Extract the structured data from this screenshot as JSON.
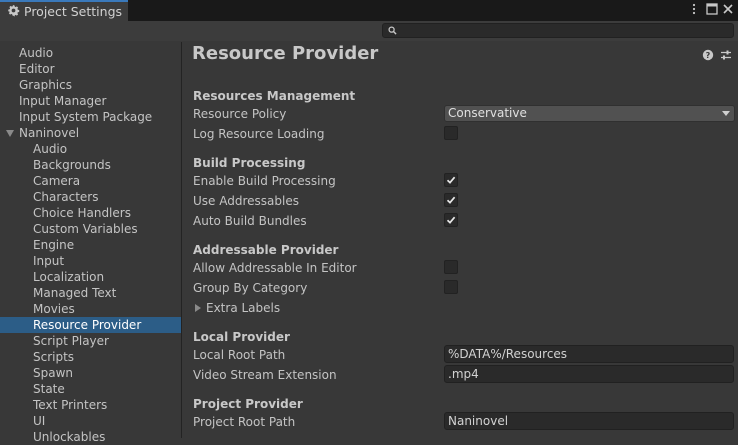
{
  "window": {
    "tab_title": "Project Settings",
    "search": {
      "value": "",
      "placeholder": ""
    }
  },
  "sidebar": {
    "items": [
      {
        "label": "Audio"
      },
      {
        "label": "Editor"
      },
      {
        "label": "Graphics"
      },
      {
        "label": "Input Manager"
      },
      {
        "label": "Input System Package"
      },
      {
        "label": "Naninovel",
        "expanded": true
      },
      {
        "label": "Audio"
      },
      {
        "label": "Backgrounds"
      },
      {
        "label": "Camera"
      },
      {
        "label": "Characters"
      },
      {
        "label": "Choice Handlers"
      },
      {
        "label": "Custom Variables"
      },
      {
        "label": "Engine"
      },
      {
        "label": "Input"
      },
      {
        "label": "Localization"
      },
      {
        "label": "Managed Text"
      },
      {
        "label": "Movies"
      },
      {
        "label": "Resource Provider",
        "selected": true
      },
      {
        "label": "Script Player"
      },
      {
        "label": "Scripts"
      },
      {
        "label": "Spawn"
      },
      {
        "label": "State"
      },
      {
        "label": "Text Printers"
      },
      {
        "label": "UI"
      },
      {
        "label": "Unlockables"
      }
    ]
  },
  "main": {
    "title": "Resource Provider",
    "resources_management": {
      "header": "Resources Management",
      "resource_policy_label": "Resource Policy",
      "resource_policy_value": "Conservative",
      "log_loading_label": "Log Resource Loading",
      "log_loading_checked": false
    },
    "build_processing": {
      "header": "Build Processing",
      "enable_label": "Enable Build Processing",
      "enable_checked": true,
      "use_addressables_label": "Use Addressables",
      "use_addressables_checked": true,
      "auto_bundles_label": "Auto Build Bundles",
      "auto_bundles_checked": true
    },
    "addressable_provider": {
      "header": "Addressable Provider",
      "allow_editor_label": "Allow Addressable In Editor",
      "allow_editor_checked": false,
      "group_label": "Group By Category",
      "group_checked": false,
      "extra_labels": "Extra Labels"
    },
    "local_provider": {
      "header": "Local Provider",
      "root_path_label": "Local Root Path",
      "root_path_value": "%DATA%/Resources",
      "video_ext_label": "Video Stream Extension",
      "video_ext_value": ".mp4"
    },
    "project_provider": {
      "header": "Project Provider",
      "root_path_label": "Project Root Path",
      "root_path_value": "Naninovel"
    }
  },
  "colors": {
    "accent": "#3a79bb",
    "selection": "#2c5d87",
    "background": "#383838"
  }
}
